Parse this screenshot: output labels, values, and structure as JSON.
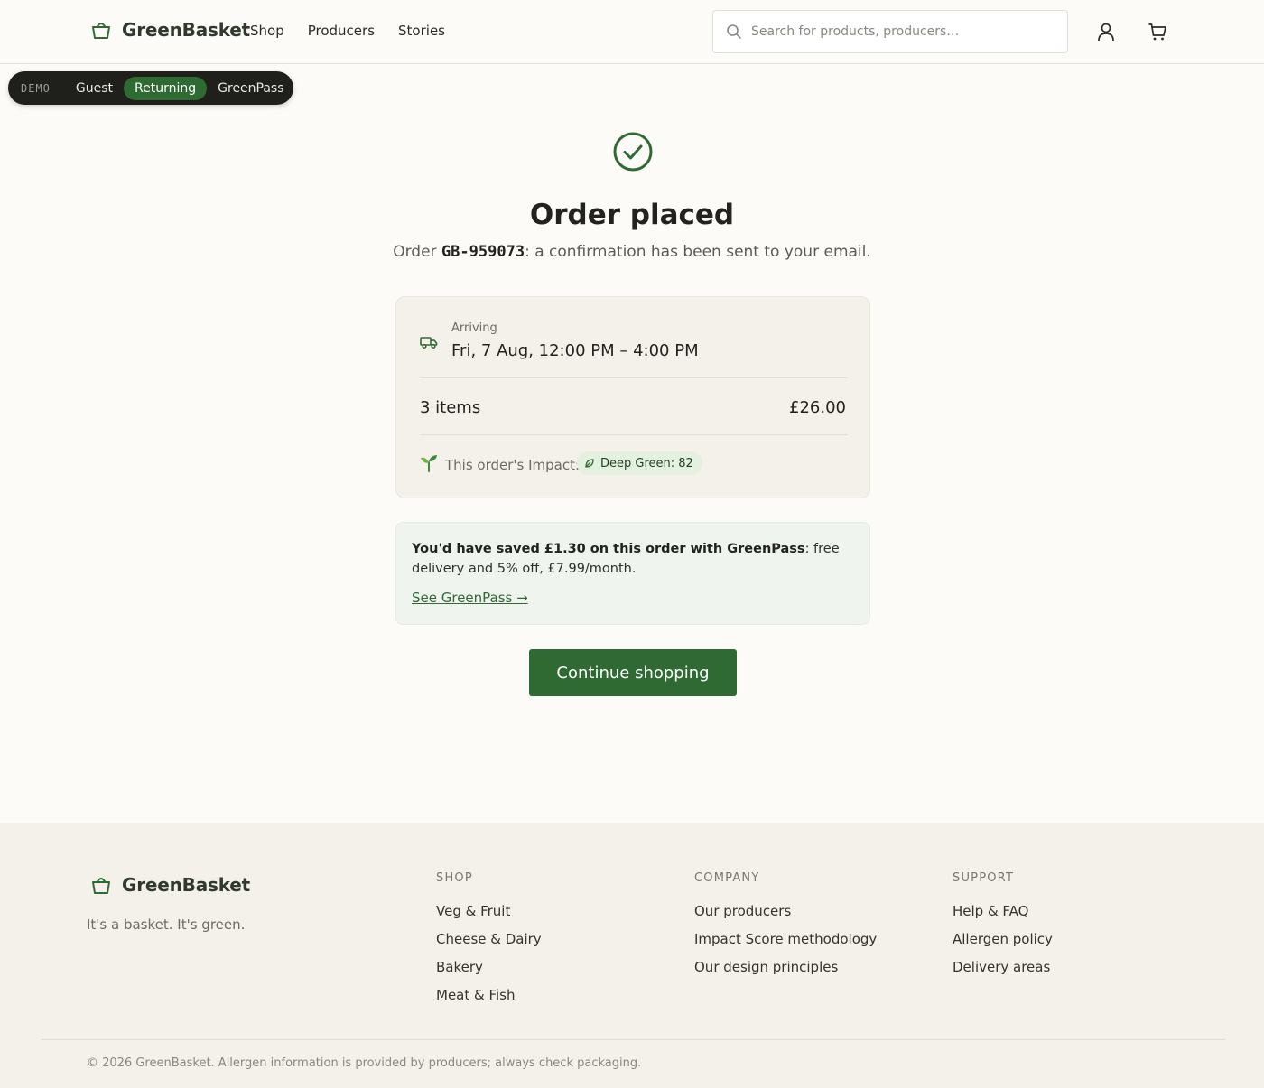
{
  "brand": {
    "name": "GreenBasket",
    "primary_color": "#2f6a33",
    "tagline": "It's a basket. It's green."
  },
  "header": {
    "nav": [
      "Shop",
      "Producers",
      "Stories"
    ],
    "search_placeholder": "Search for products, producers…",
    "icons": [
      "search-icon",
      "user-icon",
      "cart-icon"
    ]
  },
  "demo_switcher": {
    "tag": "DEMO",
    "options": [
      "Guest",
      "Returning",
      "GreenPass"
    ],
    "active": "Returning"
  },
  "confirmation": {
    "title": "Order placed",
    "order_prefix": "Order ",
    "order_code": "GB-959073",
    "order_suffix": ": a confirmation has been sent to your email.",
    "arriving_label": "Arriving",
    "arriving_date": "Fri, 7 Aug, 12:00 PM – 4:00 PM",
    "items_count": "3 items",
    "total": "£26.00",
    "impact_label": "This order's Impact:",
    "impact_badge": "Deep Green: 82"
  },
  "promo": {
    "bold": "You'd have saved £1.30 on this order with GreenPass",
    "rest": ": free delivery and 5% off, £7.99/month.",
    "link": "See GreenPass →"
  },
  "cta": {
    "label": "Continue shopping"
  },
  "footer": {
    "columns": [
      {
        "heading": "SHOP",
        "links": [
          "Veg & Fruit",
          "Cheese & Dairy",
          "Bakery",
          "Meat & Fish"
        ]
      },
      {
        "heading": "COMPANY",
        "links": [
          "Our producers",
          "Impact Score methodology",
          "Our design principles"
        ]
      },
      {
        "heading": "SUPPORT",
        "links": [
          "Help & FAQ",
          "Allergen policy",
          "Delivery areas"
        ]
      }
    ],
    "copyright": "© 2026 GreenBasket. Allergen information is provided by producers; always check packaging."
  }
}
